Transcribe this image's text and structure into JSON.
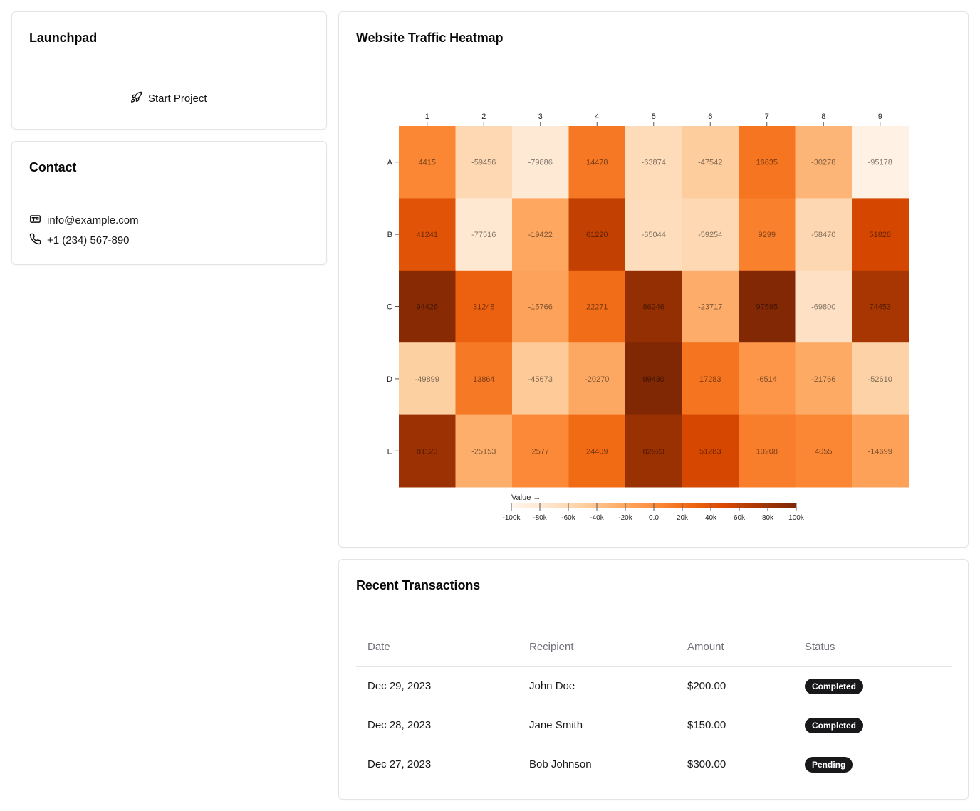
{
  "launchpad": {
    "title": "Launchpad",
    "start_label": "Start Project",
    "start_icon": "rocket-icon"
  },
  "contact": {
    "title": "Contact",
    "email": "info@example.com",
    "email_icon": "mail-icon",
    "phone": "+1 (234) 567-890",
    "phone_icon": "phone-icon"
  },
  "heatmap": {
    "title": "Website Traffic Heatmap"
  },
  "chart_data": {
    "type": "heatmap",
    "title": "Website Traffic Heatmap",
    "x": [
      "1",
      "2",
      "3",
      "4",
      "5",
      "6",
      "7",
      "8",
      "9"
    ],
    "y": [
      "A",
      "B",
      "C",
      "D",
      "E"
    ],
    "values": [
      [
        4415,
        -59456,
        -79886,
        14478,
        -63874,
        -47542,
        16635,
        -30278,
        -95178
      ],
      [
        41241,
        -77516,
        -19422,
        61220,
        -65044,
        -59254,
        9299,
        -58470,
        51828
      ],
      [
        94426,
        31248,
        -15766,
        22271,
        86246,
        -23717,
        97595,
        -69800,
        74453
      ],
      [
        -49899,
        13864,
        -45673,
        -20270,
        99430,
        17283,
        -6514,
        -21766,
        -52610
      ],
      [
        81123,
        -25153,
        2577,
        24409,
        82923,
        51283,
        10208,
        4055,
        -14699
      ]
    ],
    "color_scale": "oranges",
    "domain": [
      -100000,
      100000
    ],
    "legend": {
      "label": "Value →",
      "ticks": [
        "-100k",
        "-80k",
        "-60k",
        "-40k",
        "-20k",
        "0.0",
        "20k",
        "40k",
        "60k",
        "80k",
        "100k"
      ],
      "placement": "bottom-center"
    }
  },
  "transactions": {
    "title": "Recent Transactions",
    "columns": [
      "Date",
      "Recipient",
      "Amount",
      "Status"
    ],
    "rows": [
      {
        "date": "Dec 29, 2023",
        "recipient": "John Doe",
        "amount": "$200.00",
        "status": "Completed"
      },
      {
        "date": "Dec 28, 2023",
        "recipient": "Jane Smith",
        "amount": "$150.00",
        "status": "Completed"
      },
      {
        "date": "Dec 27, 2023",
        "recipient": "Bob Johnson",
        "amount": "$300.00",
        "status": "Pending"
      }
    ]
  }
}
